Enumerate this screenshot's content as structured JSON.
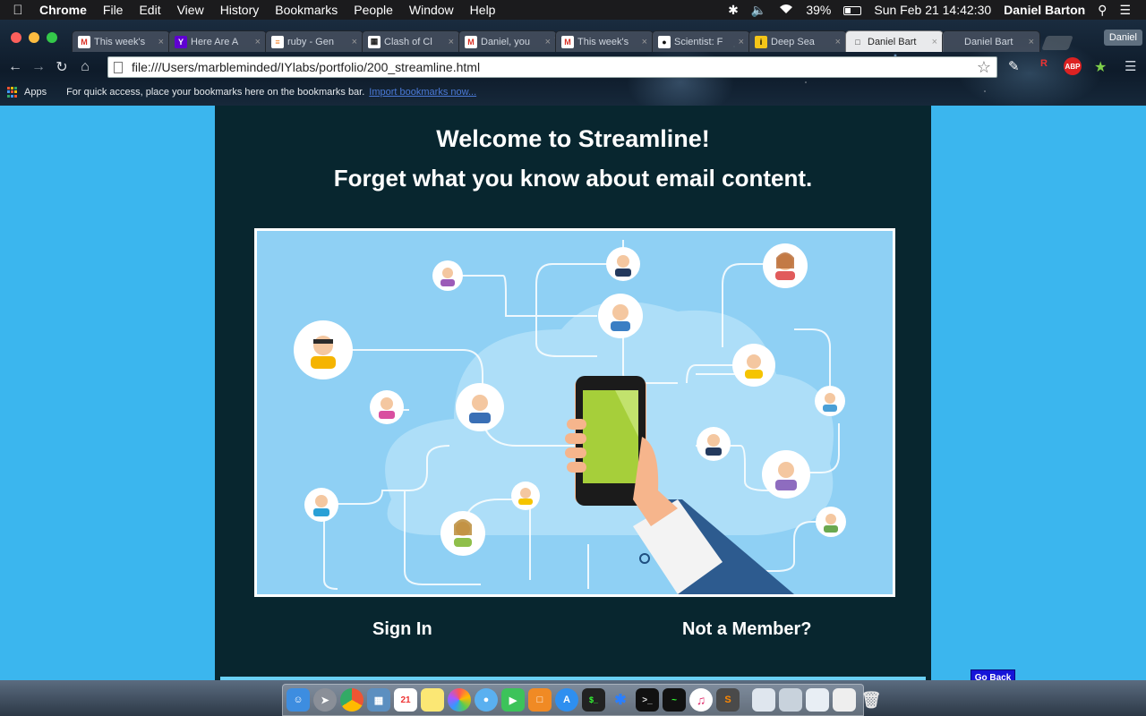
{
  "menubar": {
    "app_name": "Chrome",
    "items": [
      "File",
      "Edit",
      "View",
      "History",
      "Bookmarks",
      "People",
      "Window",
      "Help"
    ],
    "battery": "39%",
    "datetime": "Sun Feb 21  14:42:30",
    "user": "Daniel Barton"
  },
  "tabs": [
    {
      "label": "This week's",
      "icon": "gmail-icon",
      "color": "#d93025"
    },
    {
      "label": "Here Are A",
      "icon": "yahoo-icon",
      "color": "#5f01d1"
    },
    {
      "label": "ruby - Gen",
      "icon": "stackoverflow-icon",
      "color": "#f48024"
    },
    {
      "label": "Clash of Cl",
      "icon": "clash-icon",
      "color": "#222222"
    },
    {
      "label": "Daniel, you",
      "icon": "gmail-icon",
      "color": "#d93025"
    },
    {
      "label": "This week's",
      "icon": "gmail-icon",
      "color": "#d93025"
    },
    {
      "label": "Scientist: F",
      "icon": "github-icon",
      "color": "#111111"
    },
    {
      "label": "Deep Sea",
      "icon": "imdb-icon",
      "color": "#f5c518"
    },
    {
      "label": "Daniel Bart",
      "icon": "document-icon",
      "color": "#ffffff",
      "active": true
    },
    {
      "label": "Daniel Bart",
      "icon": "none",
      "color": "#ffffff"
    }
  ],
  "profile_button": "Daniel",
  "address": {
    "url": "file:///Users/marbleminded/IYlabs/portfolio/200_streamline.html"
  },
  "bookmarks_bar": {
    "apps_label": "Apps",
    "hint": "For quick access, place your bookmarks here on the bookmarks bar.",
    "import_link": "Import bookmarks now..."
  },
  "page": {
    "title": "Welcome to Streamline!",
    "subtitle": "Forget what you know about email content.",
    "sign_in": "Sign In",
    "not_member": "Not a Member?",
    "go_back": "Go Back",
    "background_color": "#3bb6ee",
    "panel_color": "#08262f"
  }
}
